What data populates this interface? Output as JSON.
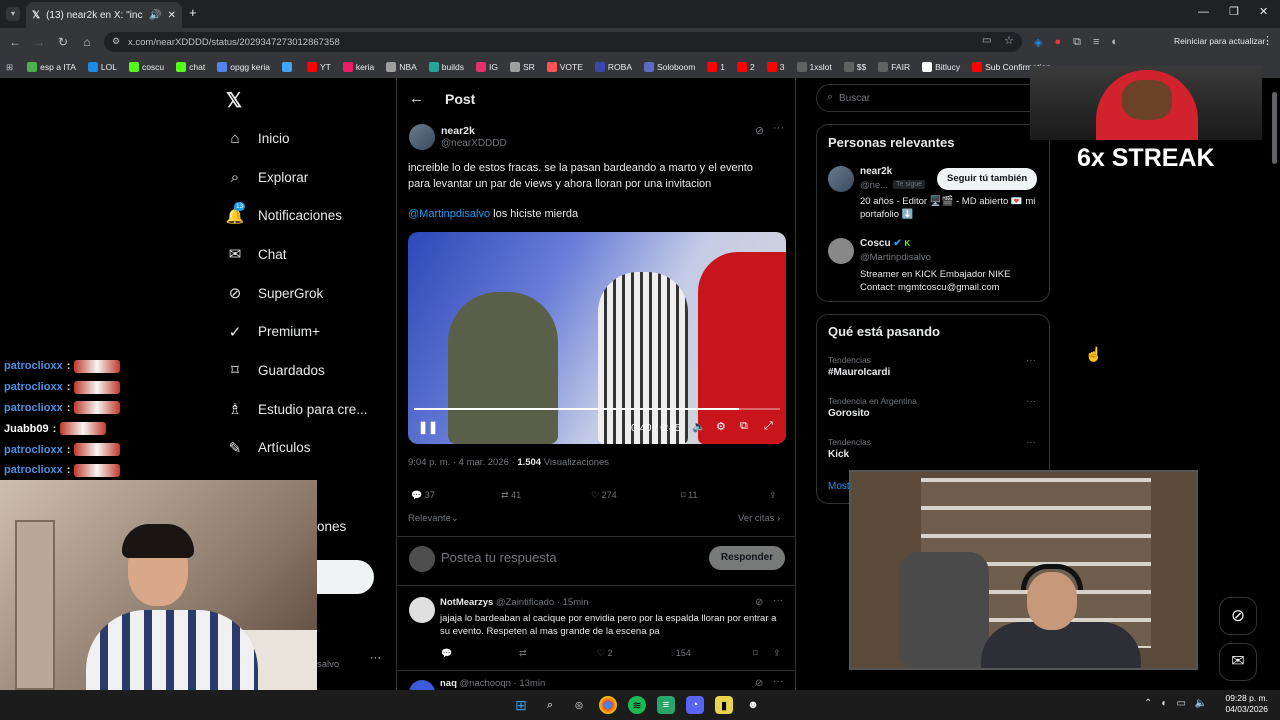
{
  "browser": {
    "tab_title": "(13) near2k en X: \"increíble",
    "url": "x.com/nearXDDDD/status/2029347273012867358",
    "update_button": "Reiniciar para actualizar",
    "bookmarks": [
      {
        "label": "esp a ITA",
        "color": "#4caf50"
      },
      {
        "label": "LOL",
        "color": "#1e88e5"
      },
      {
        "label": "coscu",
        "color": "#53fc18"
      },
      {
        "label": "chat",
        "color": "#53fc18"
      },
      {
        "label": "opgg keria",
        "color": "#5383e8"
      },
      {
        "label": "",
        "color": "#42a5f5"
      },
      {
        "label": "YT",
        "color": "#ff0000"
      },
      {
        "label": "keria",
        "color": "#e91e63"
      },
      {
        "label": "NBA",
        "color": "#9e9e9e"
      },
      {
        "label": "builds",
        "color": "#26a69a"
      },
      {
        "label": "IG",
        "color": "#e1306c"
      },
      {
        "label": "SR",
        "color": "#9e9e9e"
      },
      {
        "label": "VOTE",
        "color": "#ff5252"
      },
      {
        "label": "ROBA",
        "color": "#3949ab"
      },
      {
        "label": "Soloboom",
        "color": "#5c6bc0"
      },
      {
        "label": "1",
        "color": "#ff0000"
      },
      {
        "label": "2",
        "color": "#ff0000"
      },
      {
        "label": "3",
        "color": "#ff0000"
      },
      {
        "label": "1xslot",
        "color": "#616161"
      },
      {
        "label": "$$",
        "color": "#616161"
      },
      {
        "label": "FAIR",
        "color": "#616161"
      },
      {
        "label": "Bitlucy",
        "color": "#ffffff"
      },
      {
        "label": "Sub Confirmation",
        "color": "#ff0000"
      }
    ]
  },
  "nav": {
    "items": [
      {
        "label": "Inicio",
        "icon": "home-icon",
        "glyph": "⌂"
      },
      {
        "label": "Explorar",
        "icon": "search-icon",
        "glyph": "⌕"
      },
      {
        "label": "Notificaciones",
        "icon": "bell-icon",
        "glyph": "🔔"
      },
      {
        "label": "Chat",
        "icon": "mail-icon",
        "glyph": "✉"
      },
      {
        "label": "SuperGrok",
        "icon": "grok-icon",
        "glyph": "⊘"
      },
      {
        "label": "Premium+",
        "icon": "premium-icon",
        "glyph": "✓"
      },
      {
        "label": "Guardados",
        "icon": "bookmark-icon",
        "glyph": "⌑"
      },
      {
        "label": "Estudio para cre...",
        "icon": "studio-icon",
        "glyph": "♗"
      },
      {
        "label": "Artículos",
        "icon": "articles-icon",
        "glyph": "✎"
      }
    ],
    "notif_badge": "13",
    "partial_label": "ones",
    "partial_handle": "salvo"
  },
  "post": {
    "header": "Post",
    "author_name": "near2k",
    "author_handle": "@nearXDDDD",
    "text": "increible lo de estos fracas. se la pasan bardeando a marto y el evento para levantar un par de views y  ahora lloran por una invitacion",
    "mention": "@Martinpdisalvo",
    "mention_rest": " los hiciste mierda",
    "video_time": "0:40 / 0:45",
    "timestamp": "9:04 p. m. · 4 mar. 2026 · ",
    "views": "1.504",
    "views_label": " Visualizaciones",
    "replies": "37",
    "reposts": "41",
    "likes": "274",
    "bookmarks": "11",
    "sort": "Relevante",
    "quotes": "Ver citas",
    "reply_placeholder": "Postea tu respuesta",
    "reply_button": "Responder"
  },
  "replies": [
    {
      "name": "NotMearzys",
      "handle": "@Zaintificado · 15min",
      "text": "jajaja lo bardeaban al cacique por envidia pero por la espalda lloran por entrar a su evento. Respeten al mas grande de la escena pa",
      "comments": "",
      "reposts": "",
      "likes": "2",
      "views": "154"
    },
    {
      "name": "naq",
      "handle": "@nachooqn · 13min",
      "text": "",
      "comments": "",
      "reposts": "",
      "likes": "",
      "views": ""
    }
  ],
  "sidebar": {
    "search_placeholder": "Buscar",
    "relevant_title": "Personas relevantes",
    "people": [
      {
        "name": "near2k",
        "handle": "@ne...",
        "follows_you": "Te sigue",
        "follow_button": "Seguir tú también",
        "bio": "20 años - Editor 🖥️🎬 - MD abierto 💌 mi portafolio ⬇️"
      },
      {
        "name": "Coscu",
        "handle": "@Martinpdisalvo",
        "bio": "Streamer en KICK Embajador NIKE Contact: mgmtcoscu@gmail.com"
      }
    ],
    "trending_title": "Qué está pasando",
    "trends": [
      {
        "context": "Tendencias",
        "topic": "#MauroIcardi"
      },
      {
        "context": "Tendencia en Argentina",
        "topic": "Gorosito"
      },
      {
        "context": "Tendencias",
        "topic": "Kick"
      }
    ],
    "more": "Most"
  },
  "overlay": {
    "streak": "6x STREAK",
    "chat": [
      {
        "user": "patroclioxx",
        "color": "#4a90e2"
      },
      {
        "user": "patroclioxx",
        "color": "#4a90e2"
      },
      {
        "user": "patroclioxx",
        "color": "#4a90e2"
      },
      {
        "user": "Juabb09",
        "color": "#ffffff"
      },
      {
        "user": "patroclioxx",
        "color": "#4a90e2"
      },
      {
        "user": "patroclioxx",
        "color": "#4a90e2"
      }
    ]
  },
  "taskbar": {
    "time": "09:28 p. m.",
    "date": "04/03/2026"
  }
}
